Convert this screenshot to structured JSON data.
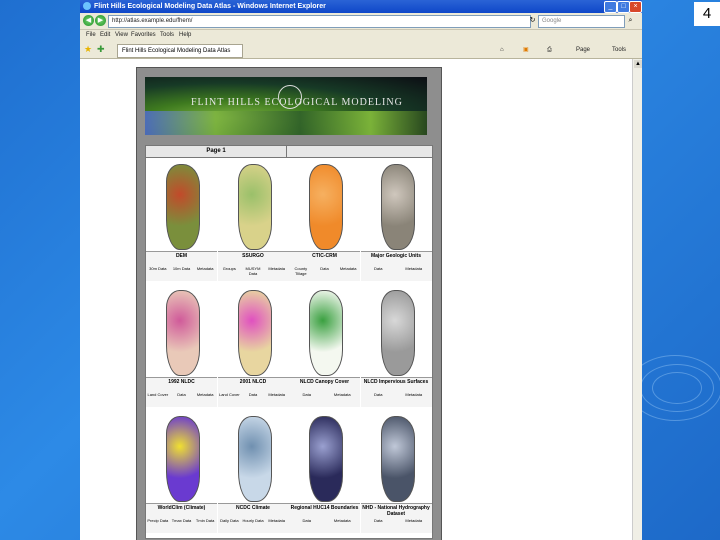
{
  "slide_number": "4",
  "browser": {
    "title": "Flint Hills Ecological Modeling Data Atlas - Windows Internet Explorer",
    "address": "http://atlas.example.edu/fhem/",
    "search_placeholder": "Google",
    "menu": [
      "File",
      "Edit",
      "View",
      "Favorites",
      "Tools",
      "Help"
    ],
    "tab_label": "Flint Hills Ecological Modeling Data Atlas",
    "tools": {
      "page": "Page",
      "tools": "Tools"
    }
  },
  "site": {
    "banner_title": "FLINT HILLS ECOLOGICAL MODELING",
    "page_label": "Page 1"
  },
  "maps": [
    {
      "title": "DEM",
      "links": [
        "30m Data",
        "10m Data",
        "Metadata"
      ],
      "color": "#7a8f3c",
      "accent": "#c24a2a"
    },
    {
      "title": "SSURGO",
      "links": [
        "Groups",
        "MUSYM Data",
        "Metadata"
      ],
      "color": "#d9d28a",
      "accent": "#9ac06a"
    },
    {
      "title": "CTIC-CRM",
      "links": [
        "County Tillage",
        "Data",
        "Metadata"
      ],
      "color": "#f08a2a",
      "accent": "#f6b060"
    },
    {
      "title": "Major Geologic Units",
      "links": [
        "Data",
        "Metadata"
      ],
      "color": "#8a8478",
      "accent": "#cfc7bd"
    },
    {
      "title": "1992 NLDC",
      "links": [
        "Land Cover",
        "Data",
        "Metadata"
      ],
      "color": "#e9c9b8",
      "accent": "#d05a9a"
    },
    {
      "title": "2001 NLCD",
      "links": [
        "Land Cover",
        "Data",
        "Metadata"
      ],
      "color": "#e8d6a0",
      "accent": "#e050c0"
    },
    {
      "title": "NLCD Canopy Cover",
      "links": [
        "Data",
        "Metadata"
      ],
      "color": "#f4f8f0",
      "accent": "#3aa040"
    },
    {
      "title": "NLCD Impervious Surfaces",
      "links": [
        "Data",
        "Metadata"
      ],
      "color": "#9a9a9a",
      "accent": "#d8d8d8"
    },
    {
      "title": "WorldClim (Climate)",
      "links": [
        "Precip Data",
        "Tmax Data",
        "Tmin Data"
      ],
      "color": "#6a3ad0",
      "accent": "#f0e030"
    },
    {
      "title": "NCDC Climate",
      "links": [
        "Daily Data",
        "Hourly Data",
        "Metadata"
      ],
      "color": "#c8d8e8",
      "accent": "#7090b0"
    },
    {
      "title": "Regional HUC14 Boundaries",
      "links": [
        "Data",
        "Metadata"
      ],
      "color": "#2a2a5a",
      "accent": "#9aa0d0"
    },
    {
      "title": "NHD - National Hydrography Dataset",
      "links": [
        "Data",
        "Metadata"
      ],
      "color": "#4a5468",
      "accent": "#c0c8d8"
    }
  ]
}
